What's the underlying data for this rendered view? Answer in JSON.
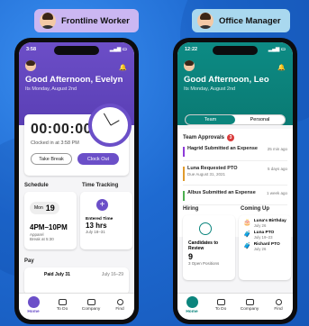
{
  "labels": {
    "frontline": "Frontline Worker",
    "manager": "Office Manager"
  },
  "worker": {
    "time": "3:58",
    "greeting": "Good Afternoon, Evelyn",
    "date": "Its Monday, August 2nd",
    "timer": "00:00:00",
    "clocked": "Clocked in at 3:58 PM",
    "take_break": "Take Break",
    "clock_out": "Clock Out",
    "schedule_title": "Schedule",
    "sched_day": "Mon",
    "sched_num": "19",
    "sched_time": "4PM–10PM",
    "sched_role": "Apparel",
    "sched_break": "Break at 5:30",
    "tracking_title": "Time Tracking",
    "entered_label": "Entered Time",
    "entered_value": "13 hrs",
    "entered_range": "July 18–31",
    "pay_title": "Pay",
    "pay_text": "Paid July 31",
    "pay_right": "July 16–29",
    "nav": [
      "Home",
      "To Do",
      "Company",
      "Find"
    ]
  },
  "manager": {
    "time": "12:22",
    "greeting": "Good Afternoon, Leo",
    "date": "Its Monday, August 2nd",
    "tab_team": "Team",
    "tab_personal": "Personal",
    "approvals_title": "Team Approvals",
    "approvals_count": "3",
    "approvals": [
      {
        "text": "Hagrid Submitted an Expense",
        "when": "25 min ago",
        "color": "#8e3bd9"
      },
      {
        "text": "Luna Requested PTO",
        "sub": "Due August 31, 2021",
        "when": "5 days ago",
        "color": "#e09b2d"
      },
      {
        "text": "Albus Submitted an Expense",
        "when": "1 week ago",
        "color": "#4caf50"
      }
    ],
    "hiring_title": "Hiring",
    "cand_label": "Candidates to Review",
    "cand_count": "9",
    "cand_open": "3 Open Positions",
    "coming_title": "Coming Up",
    "coming": [
      {
        "title": "Luna's Birthday",
        "date": "July 26"
      },
      {
        "title": "Luna PTO",
        "date": "July 19–23"
      },
      {
        "title": "Richard PTO",
        "date": "July 26"
      }
    ],
    "nav": [
      "Home",
      "To Do",
      "Company",
      "Find"
    ]
  }
}
